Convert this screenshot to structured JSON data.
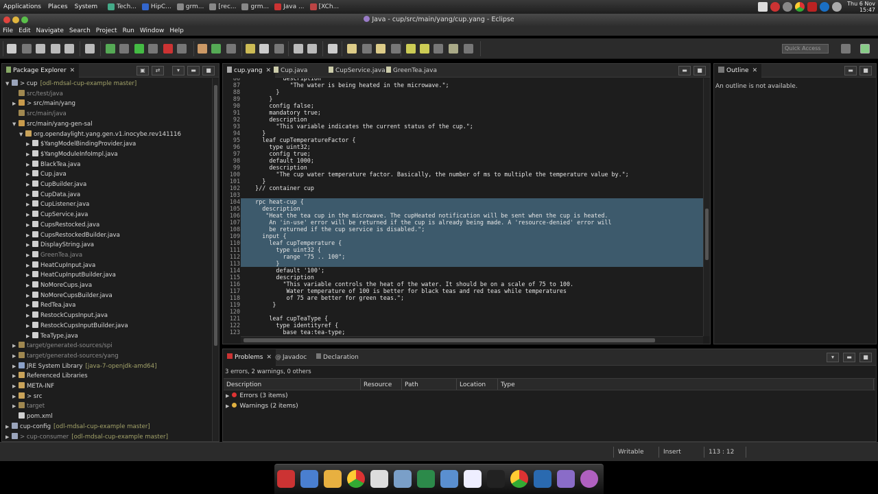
{
  "topbar": {
    "menus": [
      "Applications",
      "Places",
      "System"
    ],
    "tasks": [
      "Tech...",
      "HipC...",
      "grm...",
      "[rec...",
      "grm...",
      "Java ...",
      "[XCh..."
    ],
    "clock_day": "Thu  6 Nov",
    "clock_time": "15:47"
  },
  "window": {
    "title": "Java - cup/src/main/yang/cup.yang - Eclipse"
  },
  "menubar": [
    "File",
    "Edit",
    "Navigate",
    "Search",
    "Project",
    "Run",
    "Window",
    "Help"
  ],
  "toolbar": {
    "quick_access": "Quick Access"
  },
  "package_explorer": {
    "title": "Package Explorer",
    "rows": [
      {
        "label": "> cup",
        "dec": "[odl-mdsal-cup-example master]",
        "depth": 0,
        "twisty": "▼",
        "color": "#9aa4bb",
        "dim": false
      },
      {
        "label": "src/test/java",
        "dec": "",
        "depth": 1,
        "twisty": "",
        "color": "#a08850",
        "dim": true
      },
      {
        "label": "> src/main/yang",
        "dec": "",
        "depth": 1,
        "twisty": "▶",
        "color": "#c79a4c",
        "dim": false
      },
      {
        "label": "src/main/java",
        "dec": "",
        "depth": 1,
        "twisty": "",
        "color": "#a08850",
        "dim": true
      },
      {
        "label": "src/main/yang-gen-sal",
        "dec": "",
        "depth": 1,
        "twisty": "▼",
        "color": "#c79a4c",
        "dim": false
      },
      {
        "label": "org.opendaylight.yang.gen.v1.inocybe.rev141116",
        "dec": "",
        "depth": 2,
        "twisty": "▼",
        "color": "#c9a35a",
        "dim": false
      },
      {
        "label": "$YangModelBindingProvider.java",
        "dec": "",
        "depth": 3,
        "twisty": "▶",
        "color": "#d0d0d0",
        "dim": false
      },
      {
        "label": "$YangModuleInfoImpl.java",
        "dec": "",
        "depth": 3,
        "twisty": "▶",
        "color": "#d0d0d0",
        "dim": false
      },
      {
        "label": "BlackTea.java",
        "dec": "",
        "depth": 3,
        "twisty": "▶",
        "color": "#d0d0d0",
        "dim": false
      },
      {
        "label": "Cup.java",
        "dec": "",
        "depth": 3,
        "twisty": "▶",
        "color": "#d0d0d0",
        "dim": false
      },
      {
        "label": "CupBuilder.java",
        "dec": "",
        "depth": 3,
        "twisty": "▶",
        "color": "#d0d0d0",
        "dim": false
      },
      {
        "label": "CupData.java",
        "dec": "",
        "depth": 3,
        "twisty": "▶",
        "color": "#d0d0d0",
        "dim": false
      },
      {
        "label": "CupListener.java",
        "dec": "",
        "depth": 3,
        "twisty": "▶",
        "color": "#d0d0d0",
        "dim": false
      },
      {
        "label": "CupService.java",
        "dec": "",
        "depth": 3,
        "twisty": "▶",
        "color": "#d0d0d0",
        "dim": false
      },
      {
        "label": "CupsRestocked.java",
        "dec": "",
        "depth": 3,
        "twisty": "▶",
        "color": "#d0d0d0",
        "dim": false
      },
      {
        "label": "CupsRestockedBuilder.java",
        "dec": "",
        "depth": 3,
        "twisty": "▶",
        "color": "#d0d0d0",
        "dim": false
      },
      {
        "label": "DisplayString.java",
        "dec": "",
        "depth": 3,
        "twisty": "▶",
        "color": "#d0d0d0",
        "dim": false
      },
      {
        "label": "GreenTea.java",
        "dec": "",
        "depth": 3,
        "twisty": "▶",
        "color": "#d0d0d0",
        "dim": true
      },
      {
        "label": "HeatCupInput.java",
        "dec": "",
        "depth": 3,
        "twisty": "▶",
        "color": "#d0d0d0",
        "dim": false
      },
      {
        "label": "HeatCupInputBuilder.java",
        "dec": "",
        "depth": 3,
        "twisty": "▶",
        "color": "#d0d0d0",
        "dim": false
      },
      {
        "label": "NoMoreCups.java",
        "dec": "",
        "depth": 3,
        "twisty": "▶",
        "color": "#d0d0d0",
        "dim": false
      },
      {
        "label": "NoMoreCupsBuilder.java",
        "dec": "",
        "depth": 3,
        "twisty": "▶",
        "color": "#d0d0d0",
        "dim": false
      },
      {
        "label": "RedTea.java",
        "dec": "",
        "depth": 3,
        "twisty": "▶",
        "color": "#d0d0d0",
        "dim": false
      },
      {
        "label": "RestockCupsInput.java",
        "dec": "",
        "depth": 3,
        "twisty": "▶",
        "color": "#d0d0d0",
        "dim": false
      },
      {
        "label": "RestockCupsInputBuilder.java",
        "dec": "",
        "depth": 3,
        "twisty": "▶",
        "color": "#d0d0d0",
        "dim": false
      },
      {
        "label": "TeaType.java",
        "dec": "",
        "depth": 3,
        "twisty": "▶",
        "color": "#d0d0d0",
        "dim": false
      },
      {
        "label": "target/generated-sources/spi",
        "dec": "",
        "depth": 1,
        "twisty": "▶",
        "color": "#a08850",
        "dim": true
      },
      {
        "label": "target/generated-sources/yang",
        "dec": "",
        "depth": 1,
        "twisty": "▶",
        "color": "#a08850",
        "dim": true
      },
      {
        "label": "JRE System Library",
        "dec": "[java-7-openjdk-amd64]",
        "depth": 1,
        "twisty": "▶",
        "color": "#8aa0c8",
        "dim": false
      },
      {
        "label": "Referenced Libraries",
        "dec": "",
        "depth": 1,
        "twisty": "▶",
        "color": "#c9a35a",
        "dim": false
      },
      {
        "label": "META-INF",
        "dec": "",
        "depth": 1,
        "twisty": "▶",
        "color": "#c9a35a",
        "dim": false
      },
      {
        "label": "> src",
        "dec": "",
        "depth": 1,
        "twisty": "▶",
        "color": "#c9a35a",
        "dim": false
      },
      {
        "label": "target",
        "dec": "",
        "depth": 1,
        "twisty": "▶",
        "color": "#a08850",
        "dim": true
      },
      {
        "label": "pom.xml",
        "dec": "",
        "depth": 1,
        "twisty": "",
        "color": "#d0d0d0",
        "dim": false
      },
      {
        "label": "cup-config",
        "dec": "[odl-mdsal-cup-example master]",
        "depth": 0,
        "twisty": "▶",
        "color": "#9aa4bb",
        "dim": false
      },
      {
        "label": "> cup-consumer",
        "dec": "[odl-mdsal-cup-example master]",
        "depth": 0,
        "twisty": "▶",
        "color": "#9aa4bb",
        "dim": true
      }
    ]
  },
  "editor": {
    "tabs": [
      "cup.yang",
      "Cup.java",
      "CupService.java",
      "GreenTea.java"
    ],
    "lines": [
      {
        "n": "86",
        "t": "            description"
      },
      {
        "n": "87",
        "t": "              \"The water is being heated in the microwave.\";"
      },
      {
        "n": "88",
        "t": "          }"
      },
      {
        "n": "89",
        "t": "        }"
      },
      {
        "n": "90",
        "t": "        config false;"
      },
      {
        "n": "91",
        "t": "        mandatory true;"
      },
      {
        "n": "92",
        "t": "        description"
      },
      {
        "n": "93",
        "t": "          \"This variable indicates the current status of the cup.\";"
      },
      {
        "n": "94",
        "t": "      }"
      },
      {
        "n": "95",
        "t": "      leaf cupTemperatureFactor {"
      },
      {
        "n": "96",
        "t": "        type uint32;"
      },
      {
        "n": "97",
        "t": "        config true;"
      },
      {
        "n": "98",
        "t": "        default 1000;"
      },
      {
        "n": "99",
        "t": "        description"
      },
      {
        "n": "100",
        "t": "          \"The cup water temperature factor. Basically, the number of ms to multiple the temperature value by.\";"
      },
      {
        "n": "101",
        "t": "      }"
      },
      {
        "n": "102",
        "t": "    }// container cup"
      },
      {
        "n": "103",
        "t": ""
      },
      {
        "n": "104",
        "t": "    rpc heat-cup {"
      },
      {
        "n": "105",
        "t": "      description"
      },
      {
        "n": "106",
        "t": "       \"Heat the tea cup in the microwave. The cupHeated notification will be sent when the cup is heated."
      },
      {
        "n": "107",
        "t": "        An 'in-use' error will be returned if the cup is already being made. A 'resource-denied' error will"
      },
      {
        "n": "108",
        "t": "        be returned if the cup service is disabled.\";"
      },
      {
        "n": "109",
        "t": "      input {"
      },
      {
        "n": "110",
        "t": "        leaf cupTemperature {"
      },
      {
        "n": "111",
        "t": "          type uint32 {"
      },
      {
        "n": "112",
        "t": "            range \"75 .. 100\";"
      },
      {
        "n": "113",
        "t": "          }"
      },
      {
        "n": "114",
        "t": "          default '100';"
      },
      {
        "n": "115",
        "t": "          description"
      },
      {
        "n": "116",
        "t": "            \"This variable controls the heat of the water. It should be on a scale of 75 to 100."
      },
      {
        "n": "117",
        "t": "             Water temperature of 100 is better for black teas and red teas while temperatures"
      },
      {
        "n": "118",
        "t": "             of 75 are better for green teas.\";"
      },
      {
        "n": "119",
        "t": "         }"
      },
      {
        "n": "120",
        "t": ""
      },
      {
        "n": "121",
        "t": "        leaf cupTeaType {"
      },
      {
        "n": "122",
        "t": "          type identityref {"
      },
      {
        "n": "123",
        "t": "            base tea:tea-type;"
      }
    ],
    "selection": {
      "first": 104,
      "last": 113
    }
  },
  "outline": {
    "title": "Outline",
    "message": "An outline is not available."
  },
  "problems": {
    "tabs": [
      "Problems",
      "Javadoc",
      "Declaration"
    ],
    "summary": "3 errors, 2 warnings, 0 others",
    "columns": [
      "Description",
      "Resource",
      "Path",
      "Location",
      "Type"
    ],
    "rows": [
      {
        "label": "Errors (3 items)",
        "kind": "error"
      },
      {
        "label": "Warnings (2 items)",
        "kind": "warning"
      }
    ]
  },
  "status": {
    "writable": "Writable",
    "mode": "Insert",
    "position": "113 : 12"
  },
  "colors": {
    "selection": "#3d5a6c",
    "error": "#d33",
    "warning": "#e0b040"
  },
  "dock_icons": [
    "anchor-icon",
    "finder-icon",
    "xmpp-icon",
    "chrome-icon",
    "calculator-icon",
    "tools-icon",
    "quill-icon",
    "monitor-icon",
    "document-icon",
    "terminal-icon",
    "chrome-icon",
    "chat-icon",
    "eclipse-icon",
    "web-icon"
  ]
}
